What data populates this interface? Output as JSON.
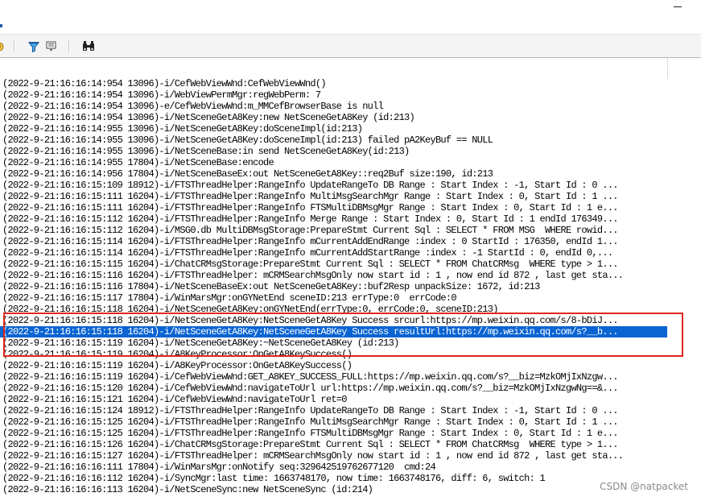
{
  "titlebar": {
    "minimize_label": "—"
  },
  "toolbar": {
    "buttons": [
      {
        "name": "refresh-icon"
      },
      {
        "name": "filter-icon"
      },
      {
        "name": "filter-settings-icon"
      },
      {
        "name": "binoculars-icon"
      }
    ]
  },
  "log": {
    "selected_index": 22,
    "lines": [
      "(2022-9-21:16:16:14:954 13096)-i/CefWebViewWnd:CefWebViewWnd()",
      "(2022-9-21:16:16:14:954 13096)-i/WebViewPermMgr:regWebPerm: 7",
      "(2022-9-21:16:16:14:954 13096)-e/CefWebViewWnd:m_MMCefBrowserBase is null",
      "(2022-9-21:16:16:14:954 13096)-i/NetSceneGetA8Key:new NetSceneGetA8Key (id:213)",
      "(2022-9-21:16:16:14:955 13096)-i/NetSceneGetA8Key:doSceneImpl(id:213)",
      "(2022-9-21:16:16:14:955 13096)-i/NetSceneGetA8Key:doSceneImpl(id:213) failed pA2KeyBuf == NULL",
      "(2022-9-21:16:16:14:955 13096)-i/NetSceneBase:in send NetSceneGetA8Key(id:213)",
      "(2022-9-21:16:16:14:955 17804)-i/NetSceneBase:encode",
      "(2022-9-21:16:16:14:956 17804)-i/NetSceneBaseEx:out NetSceneGetA8Key::req2Buf size:190, id:213",
      "(2022-9-21:16:16:15:109 18912)-i/FTSThreadHelper:RangeInfo UpdateRangeTo DB Range : Start Index : -1, Start Id : 0 ...",
      "(2022-9-21:16:16:15:111 16204)-i/FTSThreadHelper:RangeInfo MultiMsgSearchMgr Range : Start Index : 0, Start Id : 1 ...",
      "(2022-9-21:16:16:15:111 16204)-i/FTSThreadHelper:RangeInfo FTSMultiDBMsgMgr Range : Start Index : 0, Start Id : 1 e...",
      "(2022-9-21:16:16:15:112 16204)-i/FTSThreadHelper:RangeInfo Merge Range : Start Index : 0, Start Id : 1 endId 176349...",
      "(2022-9-21:16:16:15:112 16204)-i/MSG0.db MultiDBMsgStorage:PrepareStmt Current Sql : SELECT * FROM MSG  WHERE rowid...",
      "(2022-9-21:16:16:15:114 16204)-i/FTSThreadHelper:RangeInfo mCurrentAddEndRange :index : 0 StartId : 176350, endId 1...",
      "(2022-9-21:16:16:15:114 16204)-i/FTSThreadHelper:RangeInfo mCurrentAddStartRange :index : -1 StartId : 0, endId 0,...",
      "(2022-9-21:16:16:15:115 16204)-i/ChatCRMsgStorage:PrepareStmt Current Sql : SELECT * FROM ChatCRMsg  WHERE type > 1...",
      "(2022-9-21:16:16:15:116 16204)-i/FTSThreadHelper: mCRMSearchMsgOnly now start id : 1 , now end id 872 , last get sta...",
      "(2022-9-21:16:16:15:116 17804)-i/NetSceneBaseEx:out NetSceneGetA8Key::buf2Resp unpackSize: 1672, id:213",
      "(2022-9-21:16:16:15:117 17804)-i/WinMarsMgr:onGYNetEnd sceneID:213 errType:0  errCode:0",
      "(2022-9-21:16:16:15:118 16204)-i/NetSceneGetA8Key:onGYNetEnd(errType:0, errCode:0, sceneID:213)",
      "(2022-9-21:16:16:15:118 16204)-i/NetSceneGetA8Key:NetSceneGetA8Key Success srcurl:https://mp.weixin.qq.com/s/8-bDiJ...",
      "(2022-9-21:16:16:15:118 16204)-i/NetSceneGetA8Key:NetSceneGetA8Key Success resultUrl:https://mp.weixin.qq.com/s?__b...",
      "(2022-9-21:16:16:15:119 16204)-i/NetSceneGetA8Key:~NetSceneGetA8Key (id:213)",
      "(2022-9-21:16:16:15:119 16204)-i/A8KeyProcessor:OnGetA8KeySuccess()",
      "(2022-9-21:16:16:15:119 16204)-i/A8KeyProcessor:OnGetA8KeySuccess()",
      "(2022-9-21:16:16:15:119 16204)-i/CefWebViewWnd:GET_A8KEY_SUCCESS_FULL:https://mp.weixin.qq.com/s?__biz=MzkOMjIxNzgw...",
      "(2022-9-21:16:16:15:120 16204)-i/CefWebViewWnd:navigateToUrl url:https://mp.weixin.qq.com/s?__biz=MzkOMjIxNzgwNg==&...",
      "(2022-9-21:16:16:15:121 16204)-i/CefWebViewWnd:navigateToUrl ret=0",
      "(2022-9-21:16:16:15:124 18912)-i/FTSThreadHelper:RangeInfo UpdateRangeTo DB Range : Start Index : -1, Start Id : 0 ...",
      "(2022-9-21:16:16:15:125 16204)-i/FTSThreadHelper:RangeInfo MultiMsgSearchMgr Range : Start Index : 0, Start Id : 1 ...",
      "(2022-9-21:16:16:15:125 16204)-i/FTSThreadHelper:RangeInfo FTSMultiDBMsgMgr Range : Start Index : 0, Start Id : 1 e...",
      "(2022-9-21:16:16:15:126 16204)-i/ChatCRMsgStorage:PrepareStmt Current Sql : SELECT * FROM ChatCRMsg  WHERE type > 1...",
      "(2022-9-21:16:16:15:127 16204)-i/FTSThreadHelper: mCRMSearchMsgOnly now start id : 1 , now end id 872 , last get sta...",
      "(2022-9-21:16:16:16:111 17804)-i/WinMarsMgr:onNotify seq:329642519762677120  cmd:24",
      "(2022-9-21:16:16:16:112 16204)-i/SyncMgr:last time: 1663748170, now time: 1663748176, diff: 6, switch: 1",
      "(2022-9-21:16:16:16:113 16204)-i/NetSceneSync:new NetSceneSync (id:214)"
    ]
  },
  "annotation": {
    "highlight_color": "#e0261e"
  },
  "watermark": {
    "text": "CSDN @natpacket"
  },
  "colors": {
    "selection": "#0a64d2",
    "toolbar": "#f4f4f4"
  }
}
